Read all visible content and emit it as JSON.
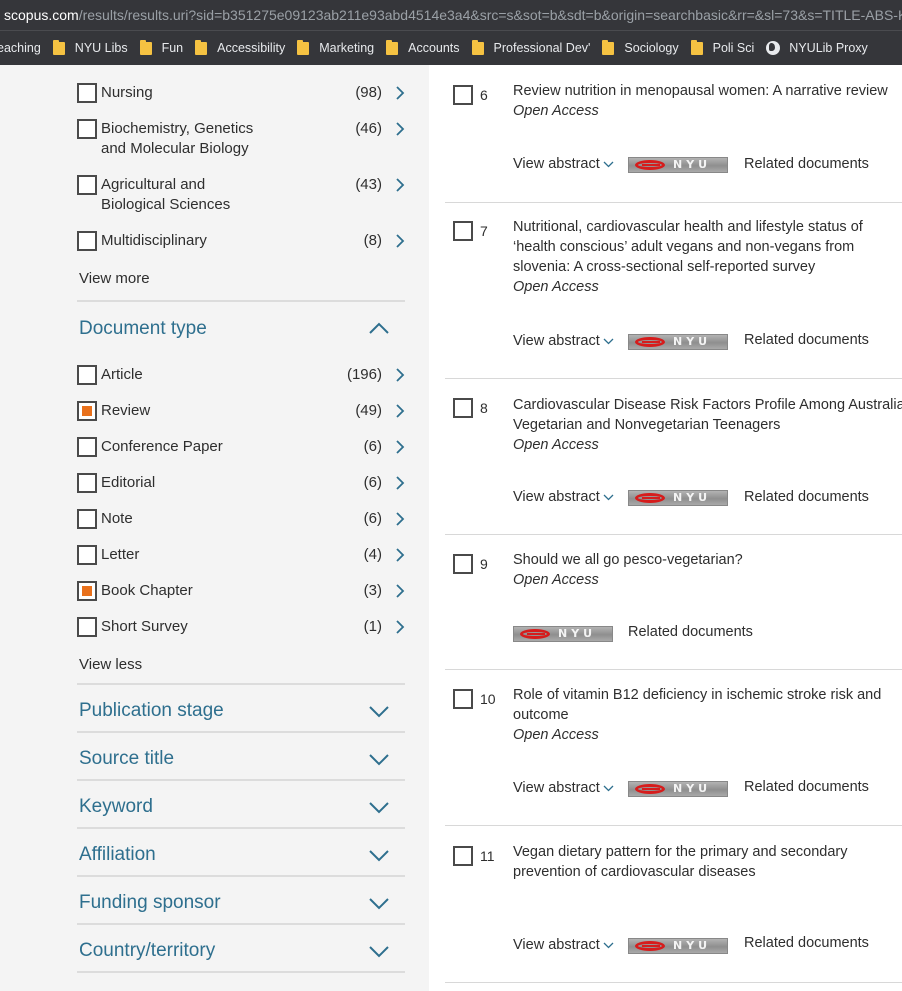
{
  "browser": {
    "url_host": "scopus.com",
    "url_path": "/results/results.uri?sid=b351275e09123ab211e93abd4514e3a4&src=s&sot=b&sdt=b&origin=searchbasic&rr=&sl=73&s=TITLE-ABS-K",
    "bookmarks": [
      {
        "label": "eaching",
        "icon": "none"
      },
      {
        "label": "NYU Libs",
        "icon": "folder-icon"
      },
      {
        "label": "Fun",
        "icon": "folder-icon"
      },
      {
        "label": "Accessibility",
        "icon": "folder-icon"
      },
      {
        "label": "Marketing",
        "icon": "folder-icon"
      },
      {
        "label": "Accounts",
        "icon": "folder-icon"
      },
      {
        "label": "Professional Dev'",
        "icon": "folder-icon"
      },
      {
        "label": "Sociology",
        "icon": "folder-icon"
      },
      {
        "label": "Poli Sci",
        "icon": "folder-icon"
      },
      {
        "label": "NYULib Proxy",
        "icon": "globe-icon"
      }
    ]
  },
  "sidebar": {
    "subject_items": [
      {
        "label": "Nursing",
        "count": "(98)",
        "checked": false
      },
      {
        "label": "Biochemistry, Genetics and Molecular Biology",
        "count": "(46)",
        "checked": false
      },
      {
        "label": "Agricultural and Biological Sciences",
        "count": "(43)",
        "checked": false
      },
      {
        "label": "Multidisciplinary",
        "count": "(8)",
        "checked": false
      }
    ],
    "view_more": "View more",
    "document_type_header": "Document type",
    "document_types": [
      {
        "label": "Article",
        "count": "(196)",
        "checked": false
      },
      {
        "label": "Review",
        "count": "(49)",
        "checked": true
      },
      {
        "label": "Conference Paper",
        "count": "(6)",
        "checked": false
      },
      {
        "label": "Editorial",
        "count": "(6)",
        "checked": false
      },
      {
        "label": "Note",
        "count": "(6)",
        "checked": false
      },
      {
        "label": "Letter",
        "count": "(4)",
        "checked": false
      },
      {
        "label": "Book Chapter",
        "count": "(3)",
        "checked": true
      },
      {
        "label": "Short Survey",
        "count": "(1)",
        "checked": false
      }
    ],
    "view_less": "View less",
    "sections": [
      "Publication stage",
      "Source title",
      "Keyword",
      "Affiliation",
      "Funding sponsor",
      "Country/territory"
    ]
  },
  "results": [
    {
      "num": "6",
      "title": "Review nutrition in menopausal women: A narrative review",
      "open_access": "Open Access",
      "view_abstract": "View abstract",
      "related": "Related documents"
    },
    {
      "num": "7",
      "title": "Nutritional, cardiovascular health and lifestyle status of ‘health conscious’ adult vegans and non-vegans from slovenia: A cross-sectional self-reported survey",
      "open_access": "Open Access",
      "view_abstract": "View abstract",
      "related": "Related documents"
    },
    {
      "num": "8",
      "title": "Cardiovascular Disease Risk Factors Profile Among Australia Vegetarian and Nonvegetarian Teenagers",
      "open_access": "Open Access",
      "view_abstract": "View abstract",
      "related": "Related documents"
    },
    {
      "num": "9",
      "title": "Should we all go pesco-vegetarian?",
      "open_access": "Open Access",
      "view_abstract": "",
      "related": "Related documents"
    },
    {
      "num": "10",
      "title": "Role of vitamin B12 deficiency in ischemic stroke risk and outcome",
      "open_access": "Open Access",
      "view_abstract": "View abstract",
      "related": "Related documents"
    },
    {
      "num": "11",
      "title": "Vegan dietary pattern for the primary and secondary prevention of cardiovascular diseases",
      "open_access": "",
      "view_abstract": "View abstract",
      "related": "Related documents"
    }
  ],
  "nyu_badge_text": "NYU",
  "colors": {
    "accent": "#2e6f8e",
    "checked": "#e9711c",
    "chrome": "#35363a"
  }
}
